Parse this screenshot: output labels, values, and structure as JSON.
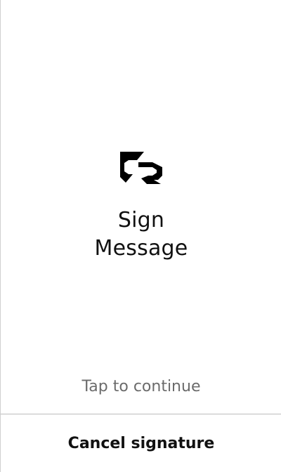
{
  "screen": {
    "logo_icon": "app-logo-icon",
    "title_line1": "Sign",
    "title_line2": "Message",
    "tap_hint": "Tap to continue"
  },
  "footer": {
    "cancel_label": "Cancel signature"
  },
  "colors": {
    "background": "#ffffff",
    "text_primary": "#111111",
    "text_secondary": "#6b6b6b",
    "divider": "#bdbdbd"
  }
}
